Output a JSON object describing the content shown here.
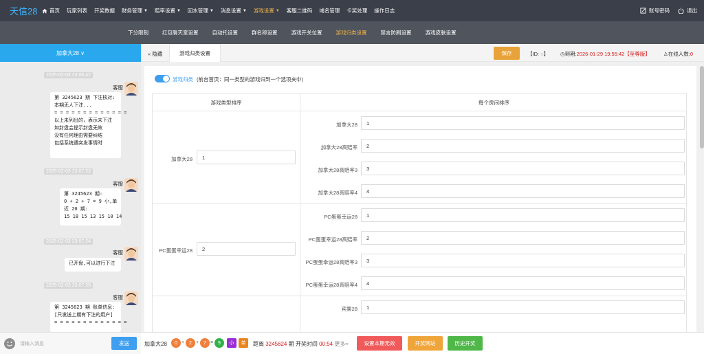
{
  "app": {
    "logo": "天信28"
  },
  "nav": [
    {
      "label": "首页",
      "caret": false,
      "active": false,
      "icon": "home-icon"
    },
    {
      "label": "玩家列表",
      "caret": false,
      "active": false
    },
    {
      "label": "开奖数据",
      "caret": false,
      "active": false
    },
    {
      "label": "财务管理",
      "caret": true,
      "active": false
    },
    {
      "label": "赔率设置",
      "caret": true,
      "active": false
    },
    {
      "label": "回水管理",
      "caret": true,
      "active": false
    },
    {
      "label": "消息设置",
      "caret": true,
      "active": false
    },
    {
      "label": "游戏设置",
      "caret": true,
      "active": true
    },
    {
      "label": "客服二维码",
      "caret": false,
      "active": false
    },
    {
      "label": "域名管理",
      "caret": false,
      "active": false
    },
    {
      "label": "卡奖处理",
      "caret": false,
      "active": false
    },
    {
      "label": "操作日志",
      "caret": false,
      "active": false
    }
  ],
  "top_right": {
    "account": "账号密码",
    "logout": "退出"
  },
  "subnav": [
    {
      "label": "下分限制",
      "active": false
    },
    {
      "label": "红包聊天室设置",
      "active": false
    },
    {
      "label": "自动托设置",
      "active": false
    },
    {
      "label": "群名称设置",
      "active": false
    },
    {
      "label": "游戏开关位置",
      "active": false
    },
    {
      "label": "游戏归类设置",
      "active": true
    },
    {
      "label": "禁言防刷设置",
      "active": false
    },
    {
      "label": "游戏皮肤设置",
      "active": false
    }
  ],
  "left_panel": {
    "title": "加拿大28 ∨"
  },
  "chat": {
    "messages": [
      {
        "time": "2025-02-03 23:06:42",
        "sender": "客服",
        "text": "第 3245623 期 下注核对:\n本期无人下注...\n= = = = = = = = = = = = =\n以上未列出的，表示未下注\n如封盘会提示封盘无效\n没有任何理由需要纠结\n包括系统遇突发事情时"
      },
      {
        "time": "2025-02-03 23:07:23",
        "sender": "客服",
        "text": "第 3245623 期:\n0 + 2 + 7 = 9 小,单\n近 20 期:\n15 18 15 13 15 10 14"
      },
      {
        "time": "2025-02-03 23:07:24",
        "sender": "客服",
        "text": "已开盘,可以进行下注"
      },
      {
        "time": "2025-02-03 23:07:25",
        "sender": "客服",
        "text": "第 3245623 期 账单信息:\n[只发送上期有下注的用户]\n= = = = = = = = = = = = ="
      }
    ],
    "input_placeholder": "请输入消息",
    "send_label": "发送"
  },
  "header": {
    "hide_label": "« 隐藏",
    "current_tab": "游戏归类设置",
    "save_label": "保存",
    "id_label": "【ID: ◌】",
    "expire_prefix": "◷到期:",
    "expire_value": "2026-01-29 19:55:42",
    "edition": "【至尊版】",
    "online_label": "♙在线人数:",
    "online_count": "0"
  },
  "settings": {
    "toggle_label": "游戏归类",
    "toggle_on": true,
    "toggle_desc": "(前台首页：同一类型的游戏归到一个选项夹中)",
    "col_type_header": "游戏类型排序",
    "col_room_header": "每个房间排序",
    "groups": [
      {
        "type_label": "加拿大28",
        "type_value": "1",
        "rooms": [
          {
            "label": "加拿大28",
            "value": "1"
          },
          {
            "label": "加拿大28高赔率",
            "value": "2"
          },
          {
            "label": "加拿大28高赔率3",
            "value": "3"
          },
          {
            "label": "加拿大28高赔率4",
            "value": "4"
          }
        ]
      },
      {
        "type_label": "PC蛋蛋幸运28",
        "type_value": "2",
        "rooms": [
          {
            "label": "PC蛋蛋幸运28",
            "value": "1"
          },
          {
            "label": "PC蛋蛋幸运28高赔率",
            "value": "2"
          },
          {
            "label": "PC蛋蛋幸运28高赔率3",
            "value": "3"
          },
          {
            "label": "PC蛋蛋幸运28高赔率4",
            "value": "4"
          }
        ]
      },
      {
        "type_label": "",
        "type_value": "",
        "rooms": [
          {
            "label": "宾果28",
            "value": "1"
          }
        ]
      }
    ]
  },
  "bottom_bar": {
    "game": "加拿大28",
    "balls": [
      "0",
      "2",
      "7",
      "9"
    ],
    "ops": [
      "+",
      "+",
      "="
    ],
    "size": "小",
    "parity": "单",
    "distance_label": "距离",
    "period": "3245624",
    "open_label": "期 开奖时间",
    "countdown": "00:54",
    "more": "更多≈",
    "btn_void": "设置本期无效",
    "btn_site": "开奖网站",
    "btn_history": "历史开奖"
  },
  "colors": {
    "accent": "#3e9ff0",
    "active_nav": "#f0b347",
    "save": "#e8a23a",
    "ball_orange": "#f0803c",
    "ball_green": "#34b24a",
    "size_purple": "#9a2fd6",
    "parity_orange": "#e8851e",
    "btn_void": "#f05a5a",
    "btn_site": "#f0a53a",
    "btn_history": "#4fb848"
  }
}
